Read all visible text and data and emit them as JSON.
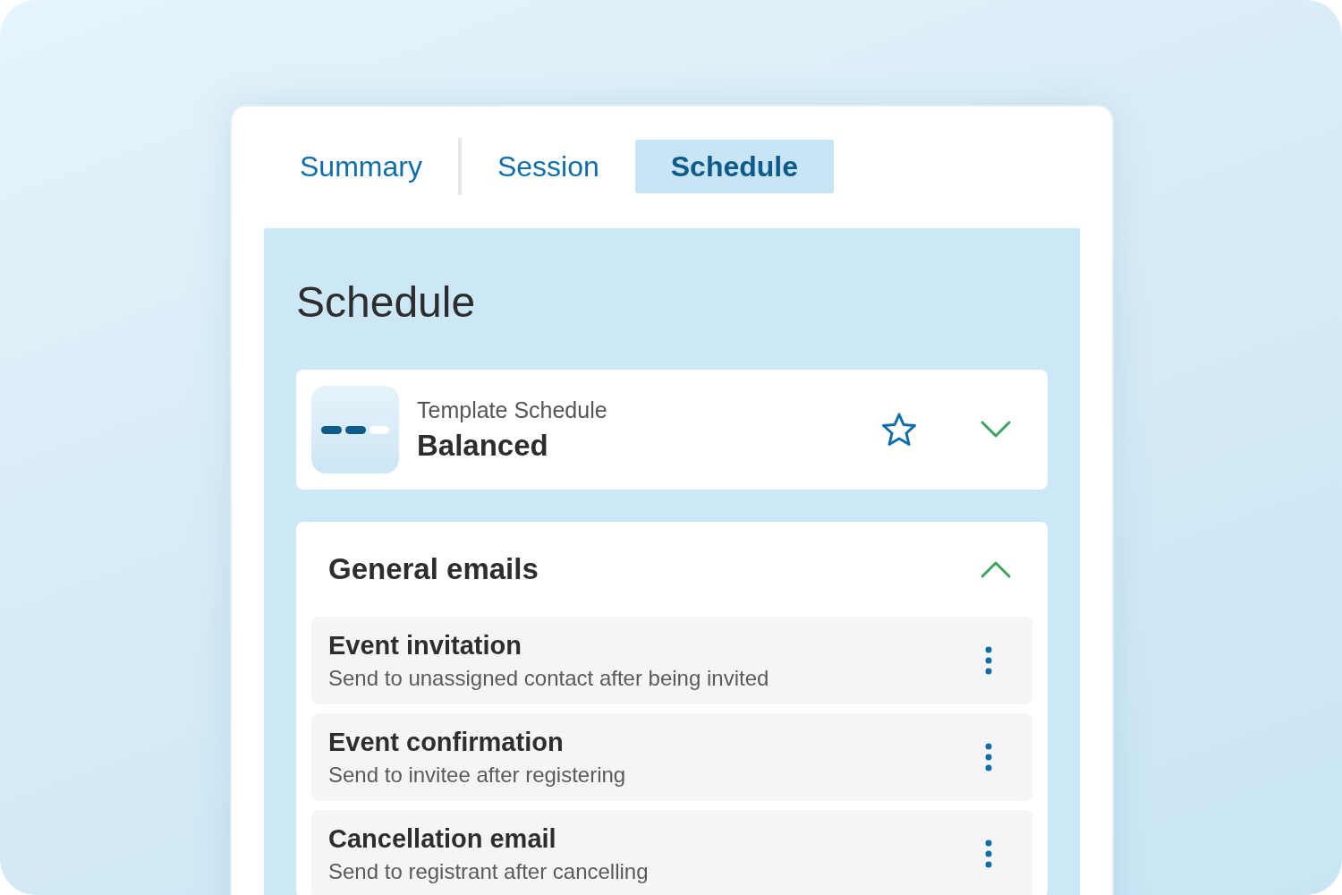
{
  "tabs": [
    {
      "label": "Summary",
      "selected": false
    },
    {
      "label": "Session",
      "selected": false
    },
    {
      "label": "Schedule",
      "selected": true
    }
  ],
  "panel": {
    "title": "Schedule"
  },
  "template": {
    "label": "Template Schedule",
    "name": "Balanced",
    "favorite": false,
    "expanded": false
  },
  "section": {
    "title": "General emails",
    "expanded": true,
    "items": [
      {
        "title": "Event invitation",
        "description": "Send to unassigned contact after being invited"
      },
      {
        "title": "Event confirmation",
        "description": "Send to invitee after registering"
      },
      {
        "title": "Cancellation email",
        "description": "Send to registrant after cancelling"
      }
    ]
  }
}
